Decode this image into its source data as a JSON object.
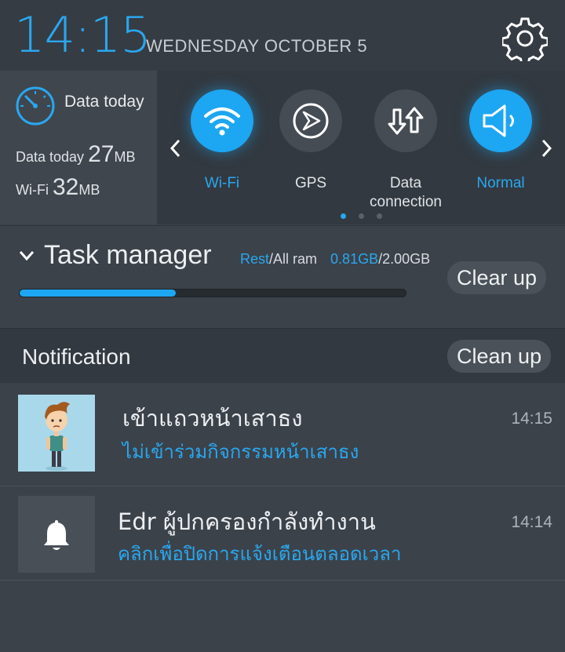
{
  "header": {
    "time": "14:15",
    "date": "WEDNESDAY  OCTOBER 5",
    "settings_icon": "gear-icon"
  },
  "data_usage": {
    "title": "Data today",
    "rows": [
      {
        "label": "Data today",
        "value": "27",
        "unit": "MB"
      },
      {
        "label": "Wi-Fi",
        "value": "32",
        "unit": "MB"
      }
    ]
  },
  "quick_toggles": [
    {
      "label": "Wi-Fi",
      "icon": "wifi-icon",
      "active": true
    },
    {
      "label": "GPS",
      "icon": "gps-icon",
      "active": false
    },
    {
      "label": "Data connection",
      "icon": "data-connection-icon",
      "active": false
    },
    {
      "label": "Normal",
      "icon": "speaker-icon",
      "active": true
    }
  ],
  "pager": {
    "pages": 3,
    "current": 1
  },
  "task_manager": {
    "title": "Task manager",
    "rest_label": "Rest",
    "ram_label": "/All ram",
    "used": "0.81GB",
    "total": "/2.00GB",
    "ratio": 0.405,
    "clear_button": "Clear up"
  },
  "notification": {
    "title": "Notification",
    "clean_button": "Clean up",
    "items": [
      {
        "title": "เข้าแถวหน้าเสาธง",
        "subtitle": "ไม่เข้าร่วมกิจกรรมหน้าเสาธง",
        "time": "14:15",
        "thumb": "boy-avatar"
      },
      {
        "title": "Edr ผู้ปกครองกำลังทำงาน",
        "subtitle": "คลิกเพื่อปิดการแจ้งเตือนตลอดเวลา",
        "time": "14:14",
        "thumb": "bell-icon"
      }
    ]
  },
  "colors": {
    "accent": "#1da6f2",
    "background": "#3b424a"
  }
}
